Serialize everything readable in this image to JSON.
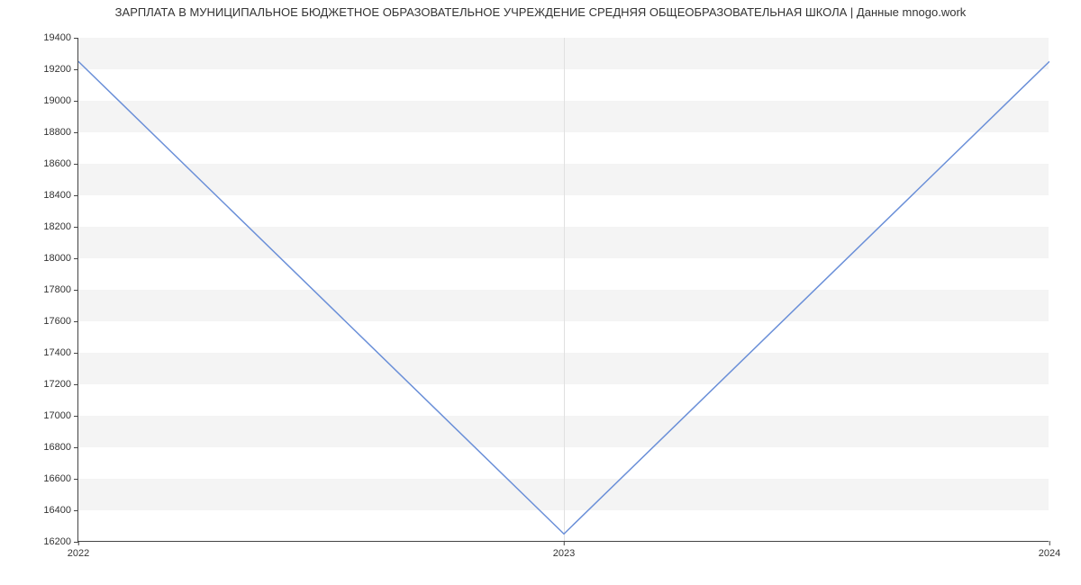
{
  "chart_data": {
    "type": "line",
    "title": "ЗАРПЛАТА В МУНИЦИПАЛЬНОЕ БЮДЖЕТНОЕ ОБРАЗОВАТЕЛЬНОЕ УЧРЕЖДЕНИЕ СРЕДНЯЯ ОБЩЕОБРАЗОВАТЕЛЬНАЯ ШКОЛА | Данные mnogo.work",
    "categories": [
      "2022",
      "2023",
      "2024"
    ],
    "values": [
      19250,
      16250,
      19250
    ],
    "xlabel": "",
    "ylabel": "",
    "ylim": [
      16200,
      19400
    ],
    "y_ticks": [
      16200,
      16400,
      16600,
      16800,
      17000,
      17200,
      17400,
      17600,
      17800,
      18000,
      18200,
      18400,
      18600,
      18800,
      19000,
      19200,
      19400
    ],
    "line_color": "#6a8fd8"
  }
}
